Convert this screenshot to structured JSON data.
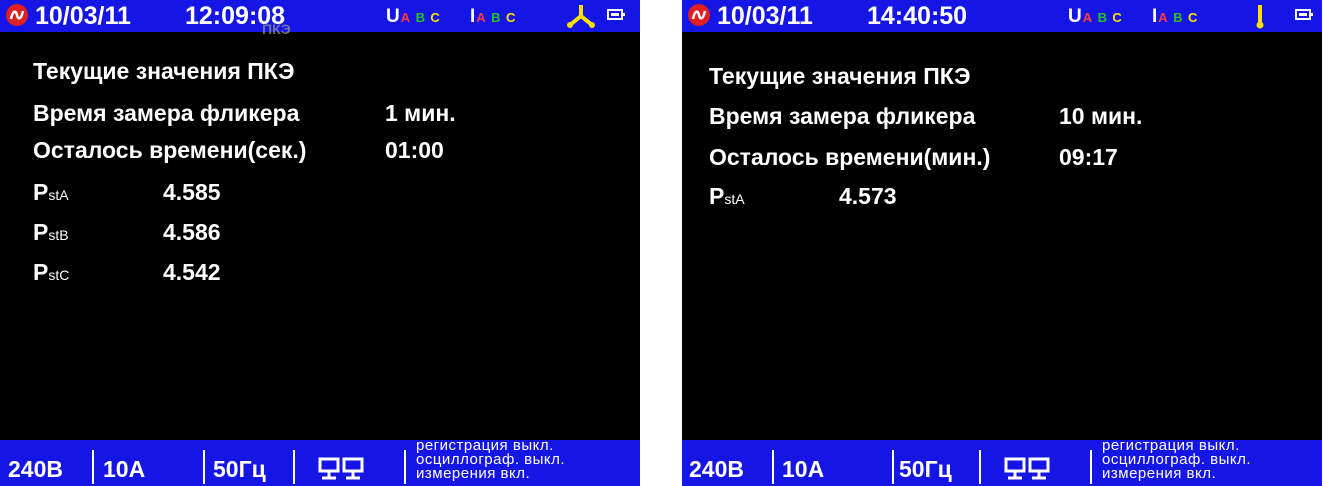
{
  "colors": {
    "bar_background": "#1515e6",
    "screen_background": "#000000",
    "text": "#ffffff",
    "phase_a": "#ff3b3b",
    "phase_b": "#22c322",
    "phase_c": "#ffe000",
    "mode_icon": "#ffe000",
    "logo": "#e02020"
  },
  "screens": [
    {
      "header": {
        "date": "10/03/11",
        "time": "12:09:08",
        "voltage_label": "U",
        "current_label": "I",
        "phase_labels": [
          "A",
          "B",
          "C"
        ],
        "mode_icon": "three-phase-star-icon",
        "battery_icon": "battery-icon"
      },
      "ghost_text": "ПКЭ",
      "title": "Текущие значения ПКЭ",
      "flicker_time_label": "Время замера фликера",
      "flicker_time_value": "1 мин.",
      "remaining_label": "Осталось времени(сек.)",
      "remaining_value": "01:00",
      "pst": [
        {
          "main": "P",
          "sub": "stA",
          "value": "4.585"
        },
        {
          "main": "P",
          "sub": "stB",
          "value": "4.586"
        },
        {
          "main": "P",
          "sub": "stC",
          "value": "4.542"
        }
      ],
      "footer": {
        "voltage": "240В",
        "current": "10А",
        "frequency": "50Гц",
        "network_icon": "network-computers-icon",
        "status_lines": [
          "регистрация выкл.",
          "осциллограф. выкл.",
          "измерения вкл."
        ]
      }
    },
    {
      "header": {
        "date": "10/03/11",
        "time": "14:40:50",
        "voltage_label": "U",
        "current_label": "I",
        "phase_labels": [
          "A",
          "B",
          "C"
        ],
        "mode_icon": "single-phase-arrow-icon",
        "battery_icon": "battery-icon"
      },
      "title": "Текущие значения ПКЭ",
      "flicker_time_label": "Время замера фликера",
      "flicker_time_value": "10 мин.",
      "remaining_label": "Осталось времени(мин.)",
      "remaining_value": "09:17",
      "pst": [
        {
          "main": "P",
          "sub": "stA",
          "value": "4.573"
        }
      ],
      "footer": {
        "voltage": "240В",
        "current": "10А",
        "frequency": "50Гц",
        "network_icon": "network-computers-icon",
        "status_lines": [
          "регистрация выкл.",
          "осциллограф. выкл.",
          "измерения вкл."
        ]
      }
    }
  ]
}
